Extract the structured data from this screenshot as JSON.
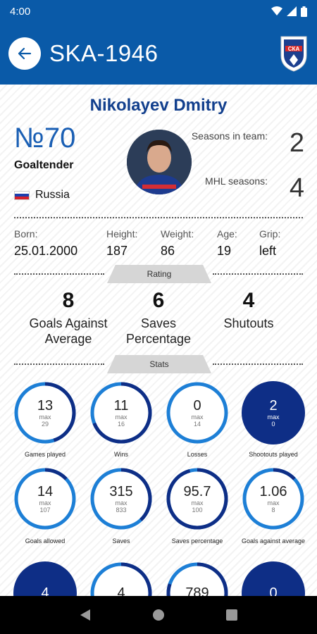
{
  "status": {
    "time": "4:00"
  },
  "header": {
    "title": "SKA-1946",
    "logo_text": "СКА"
  },
  "player": {
    "name": "Nikolayev Dmitry",
    "number": "№70",
    "position": "Goaltender",
    "country": "Russia",
    "seasons_in_team_label": "Seasons in team:",
    "seasons_in_team": "2",
    "mhl_seasons_label": "MHL seasons:",
    "mhl_seasons": "4"
  },
  "bio": {
    "born_label": "Born:",
    "born": "25.01.2000",
    "height_label": "Height:",
    "height": "187",
    "weight_label": "Weight:",
    "weight": "86",
    "age_label": "Age:",
    "age": "19",
    "grip_label": "Grip:",
    "grip": "left"
  },
  "rating": {
    "tab": "Rating",
    "items": [
      {
        "value": "8",
        "label_1": "Goals Against",
        "label_2": "Average"
      },
      {
        "value": "6",
        "label_1": "Saves",
        "label_2": "Percentage"
      },
      {
        "value": "4",
        "label_1": "Shutouts",
        "label_2": ""
      }
    ]
  },
  "stats": {
    "tab": "Stats",
    "items": [
      {
        "value": "13",
        "max_label": "max",
        "max": "29",
        "label": "Games played",
        "fraction": 0.45,
        "filled": false
      },
      {
        "value": "11",
        "max_label": "max",
        "max": "16",
        "label": "Wins",
        "fraction": 0.69,
        "filled": false
      },
      {
        "value": "0",
        "max_label": "max",
        "max": "14",
        "label": "Losses",
        "fraction": 0.0,
        "filled": false
      },
      {
        "value": "2",
        "max_label": "max",
        "max": "0",
        "label": "Shootouts played",
        "fraction": 1.0,
        "filled": true
      },
      {
        "value": "14",
        "max_label": "max",
        "max": "107",
        "label": "Goals allowed",
        "fraction": 0.13,
        "filled": false
      },
      {
        "value": "315",
        "max_label": "max",
        "max": "833",
        "label": "Saves",
        "fraction": 0.38,
        "filled": false
      },
      {
        "value": "95.7",
        "max_label": "max",
        "max": "100",
        "label": "Saves percentage",
        "fraction": 0.957,
        "filled": false
      },
      {
        "value": "1.06",
        "max_label": "max",
        "max": "8",
        "label": "Goals against average",
        "fraction": 0.13,
        "filled": false
      },
      {
        "value": "4",
        "max_label": "",
        "max": "",
        "label": "",
        "fraction": 1.0,
        "filled": true
      },
      {
        "value": "4",
        "max_label": "",
        "max": "",
        "label": "",
        "fraction": 0.3,
        "filled": false
      },
      {
        "value": "789",
        "max_label": "",
        "max": "",
        "label": "",
        "fraction": 0.8,
        "filled": false
      },
      {
        "value": "0",
        "max_label": "",
        "max": "",
        "label": "",
        "fraction": 1.0,
        "filled": true
      }
    ]
  },
  "colors": {
    "primary": "#0a5aa8",
    "ring_dark": "#0e2e86",
    "ring_light": "#1d7fd6",
    "name": "#123f8d"
  }
}
